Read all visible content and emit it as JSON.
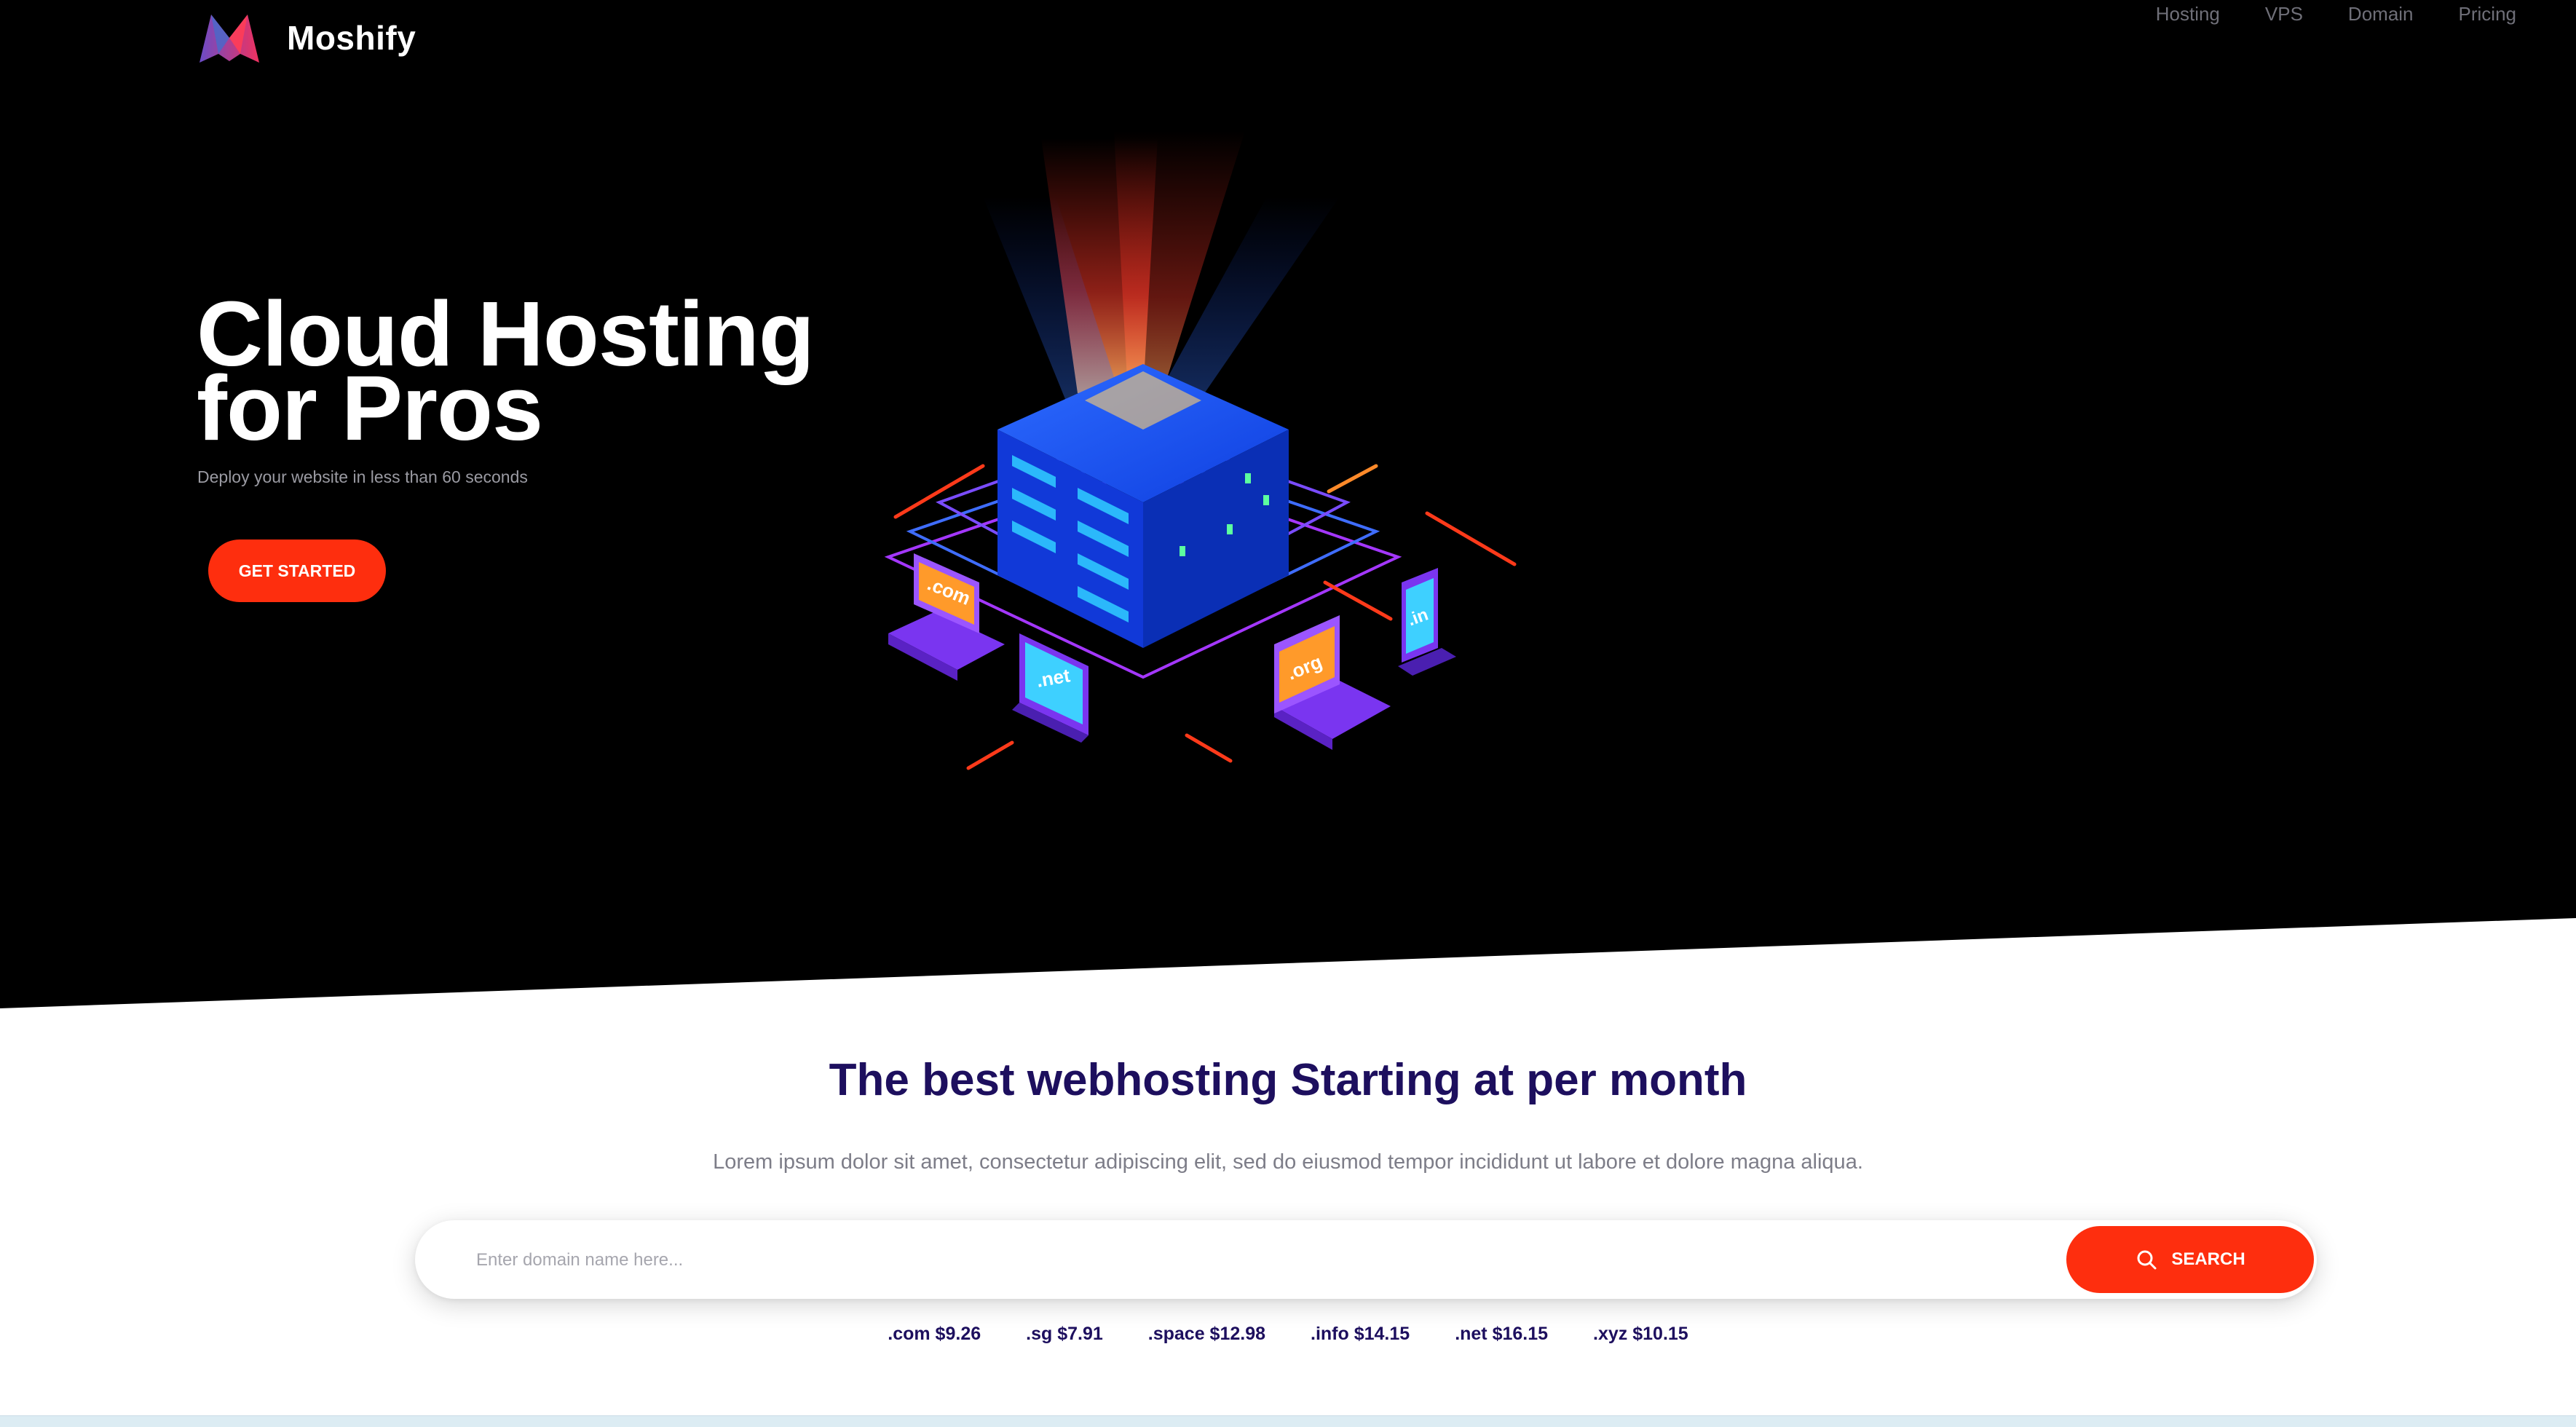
{
  "brand": {
    "name": "Moshify"
  },
  "nav": {
    "items": [
      "Hosting",
      "VPS",
      "Domain",
      "Pricing"
    ]
  },
  "hero": {
    "title_line1": "Cloud Hosting",
    "title_line2": "for Pros",
    "subtitle": "Deploy your website in less than 60 seconds",
    "cta_label": "GET STARTED",
    "illustration_labels": [
      ".com",
      ".net",
      ".org",
      ".in"
    ]
  },
  "section": {
    "title": "The best webhosting Starting at per month",
    "description": "Lorem ipsum dolor sit amet, consectetur adipiscing elit, sed do eiusmod tempor incididunt ut labore et dolore magna aliqua."
  },
  "search": {
    "placeholder": "Enter domain name here...",
    "button_label": "SEARCH",
    "icon": "search-icon"
  },
  "tlds": [
    ".com $9.26",
    ".sg $7.91",
    ".space $12.98",
    ".info $14.15",
    ".net $16.15",
    ".xyz $10.15"
  ],
  "colors": {
    "accent": "#fe2e0e",
    "heading": "#1d0f5e",
    "hero_bg": "#000000",
    "server_blue": "#1456ff",
    "device_purple": "#7b3cff"
  }
}
